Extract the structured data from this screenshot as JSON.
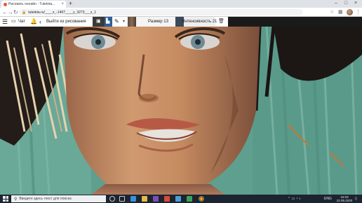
{
  "browser": {
    "tab_title": "Рисовать онлайн - Tuteleta...",
    "tab_close": "×",
    "new_tab": "+",
    "window_controls": [
      "–",
      "□",
      "×"
    ],
    "url": "tuteleta.ru/____x_-1407____y_3273___z_1",
    "nav": {
      "back": "←",
      "forward": "→",
      "reload": "↻"
    }
  },
  "app_toolbar": {
    "menu_icon": "hamburger-icon",
    "chat_label": "Чат",
    "exit_label": "Выйти из рисования",
    "size_label": "Размер 13",
    "intensity_label": "Интенсивность 21"
  },
  "taskbar": {
    "search_placeholder": "Введите здесь текст для поиска",
    "language": "ENG",
    "time": "15:03",
    "date": "22.05.2020"
  },
  "colors": {
    "canvas_teal": "#5e9f8f",
    "skin": "#c08a63",
    "hair": "#1a1512",
    "toolbar_accent": "#2f5f9a"
  }
}
